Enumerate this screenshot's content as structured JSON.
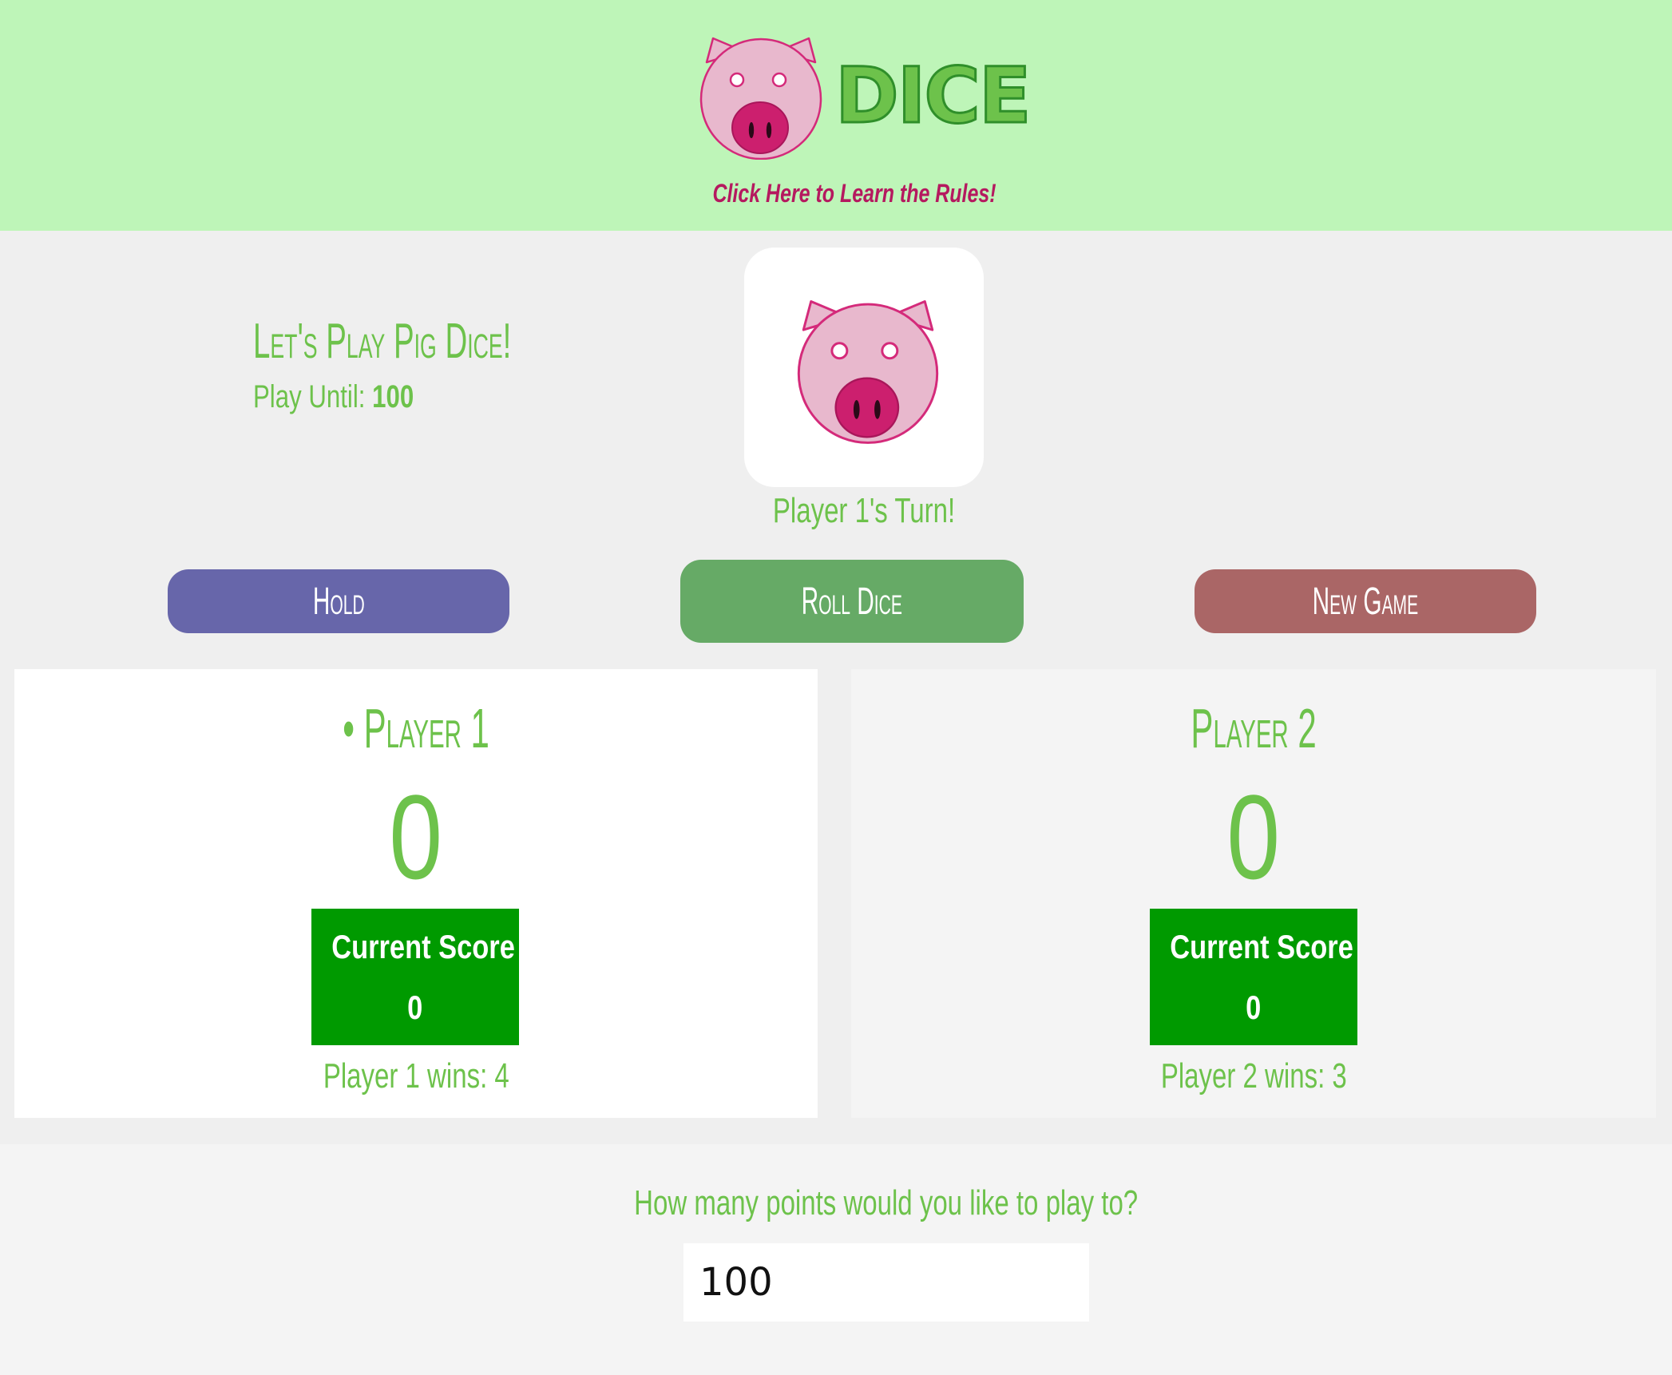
{
  "header": {
    "logo_text": "DICE",
    "rules_link": "Click Here to Learn the Rules!"
  },
  "intro": {
    "title": "Let's Play Pig Dice!",
    "play_until_label": "Play Until:",
    "play_until_value": "100"
  },
  "dice": {
    "icon": "pig-face-icon",
    "turn_text": "Player 1's Turn!"
  },
  "controls": {
    "hold_label": "Hold",
    "roll_label": "Roll Dice",
    "new_game_label": "New Game"
  },
  "players": [
    {
      "name": "• Player 1",
      "total_score": "0",
      "current_label": "Current Score",
      "current_value": "0",
      "wins_text": "Player 1 wins: 4",
      "active": true
    },
    {
      "name": "Player 2",
      "total_score": "0",
      "current_label": "Current Score",
      "current_value": "0",
      "wins_text": "Player 2 wins: 3",
      "active": false
    }
  ],
  "settings": {
    "question": "How many points would you like to play to?",
    "points_value": "100"
  },
  "colors": {
    "header_bg": "#bef5b8",
    "accent_green": "#6dc24b",
    "hold": "#6766aa",
    "roll": "#66aa66",
    "new_game": "#aa6666",
    "current_box": "#009a00",
    "pig_pink": "#e8b8cd",
    "pig_magenta": "#d42a7a"
  }
}
